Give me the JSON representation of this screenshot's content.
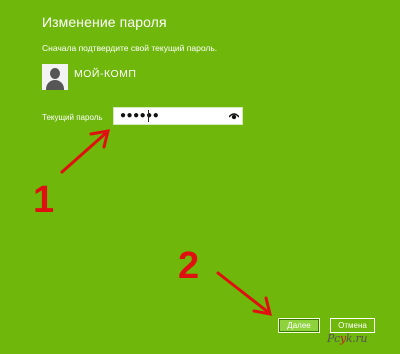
{
  "dialog": {
    "title": "Изменение пароля",
    "subtitle": "Сначала подтвердите свой текущий пароль.",
    "user": {
      "name": "МОЙ-КОМП",
      "avatar_icon": "user-avatar-icon"
    },
    "password_field": {
      "label": "Текущий пароль",
      "masked_value": "●●●●●●",
      "reveal_icon": "eye-icon"
    },
    "buttons": {
      "next_label": "Далее",
      "cancel_label": "Отмена"
    }
  },
  "annotations": {
    "step1_label": "1",
    "step2_label": "2",
    "color": "#e01010"
  },
  "watermark": {
    "part1": "Pc",
    "part2": "y",
    "part3": "k.ru"
  },
  "colors": {
    "background": "#6fb70a",
    "primary_button": "#8ed33d",
    "text": "#ffffff"
  }
}
